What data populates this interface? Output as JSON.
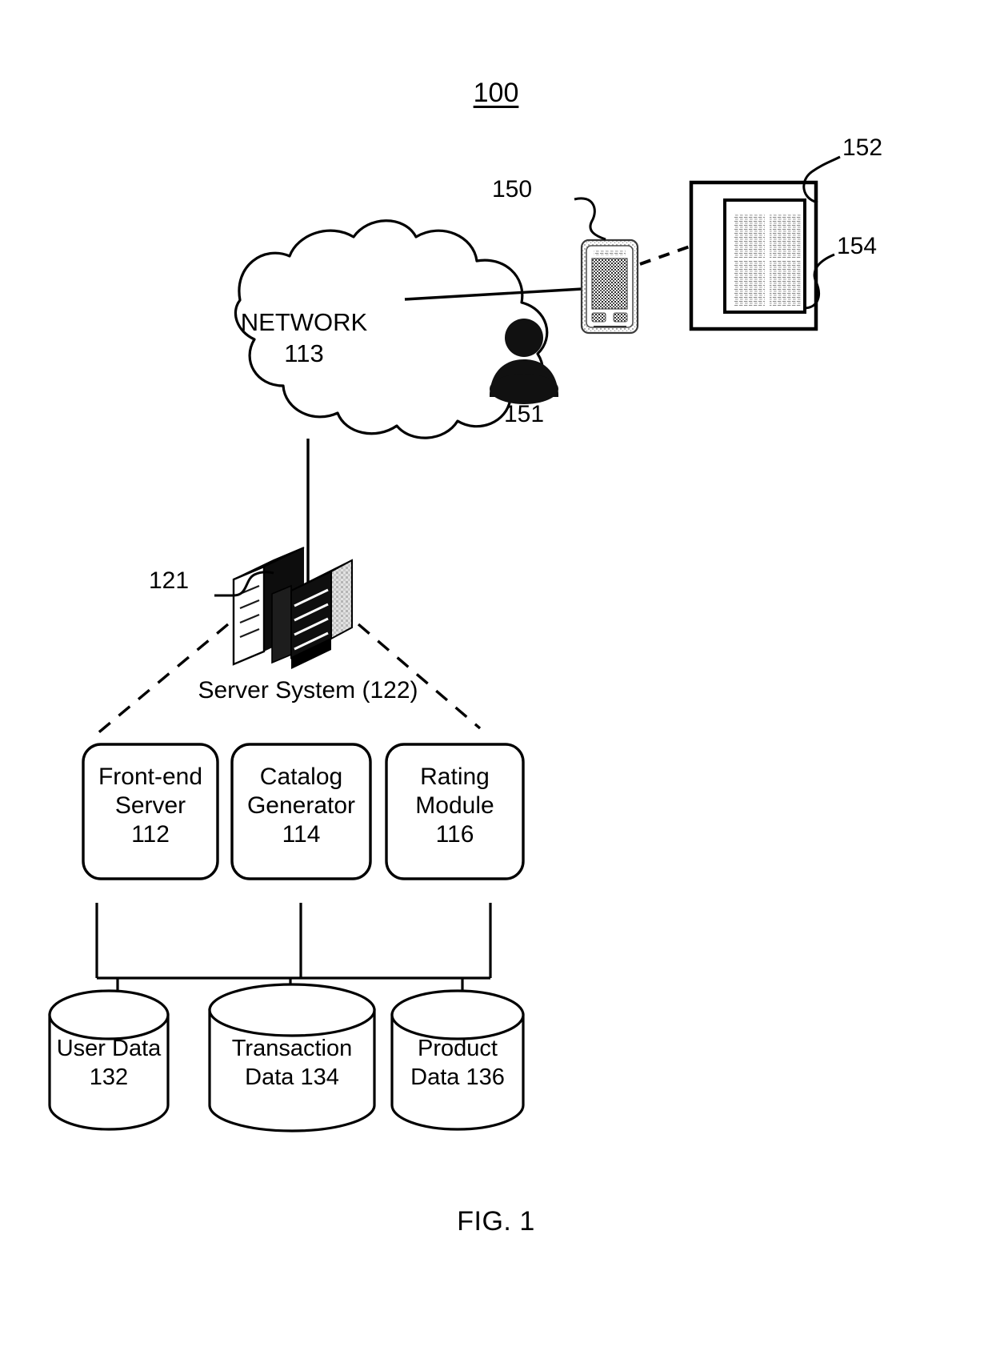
{
  "figure": {
    "top_number": "100",
    "caption": "FIG. 1"
  },
  "network": {
    "name": "NETWORK",
    "number": "113"
  },
  "devices": {
    "phone_ref": "150",
    "user_ref": "151",
    "display_ref": "152",
    "content_ref": "154",
    "server_ref": "121"
  },
  "server_system": {
    "label": "Server System (122)"
  },
  "modules": [
    {
      "line1": "Front-end",
      "line2": "Server",
      "number": "112"
    },
    {
      "line1": "Catalog",
      "line2": "Generator",
      "number": "114"
    },
    {
      "line1": "Rating",
      "line2": "Module",
      "number": "116"
    }
  ],
  "databases": [
    {
      "line1": "User Data",
      "line2": "132"
    },
    {
      "line1": "Transaction",
      "line2": "Data 134"
    },
    {
      "line1": "Product",
      "line2": "Data 136"
    }
  ],
  "colors": {
    "stroke": "#000000",
    "background": "#ffffff",
    "fill_dark": "#1a1a1a"
  }
}
